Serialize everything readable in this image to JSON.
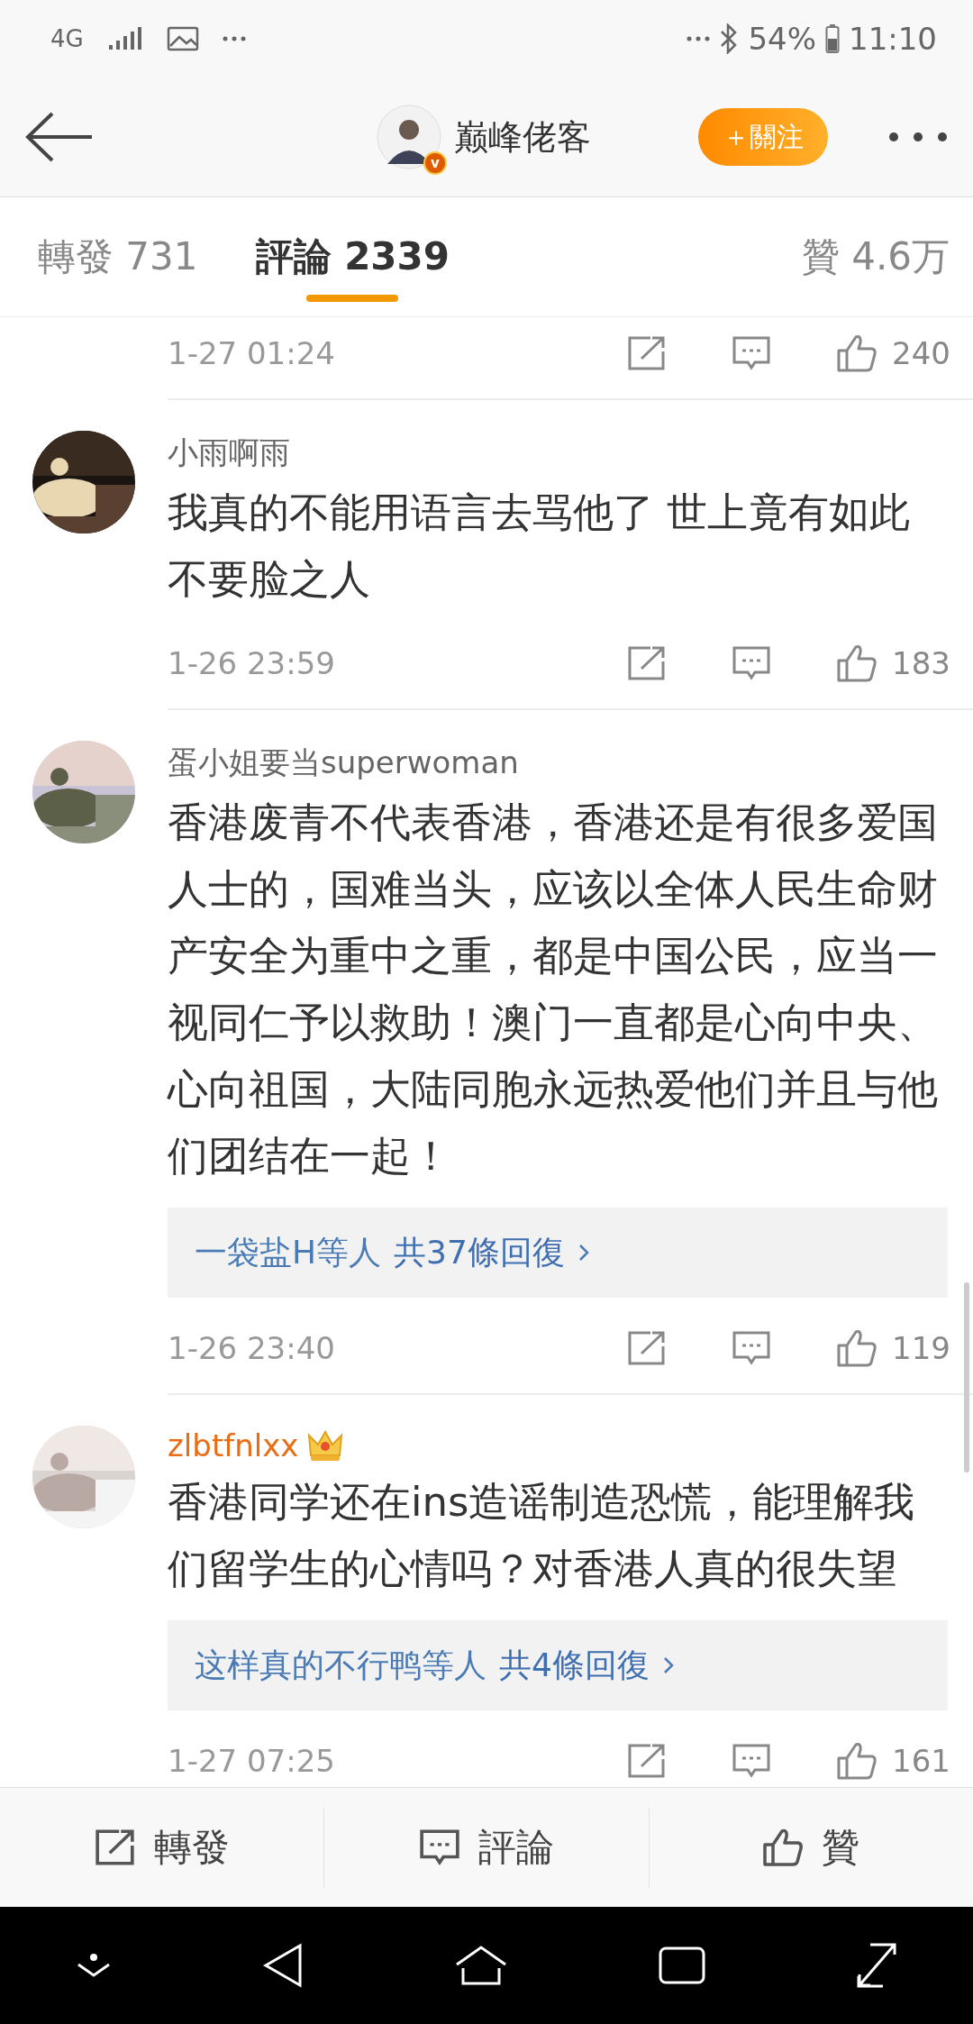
{
  "status_bar": {
    "network": "4G",
    "battery": "54%",
    "time": "11:10"
  },
  "header": {
    "title": "巅峰佬客",
    "badge": "v",
    "follow_button": "＋關注"
  },
  "tabs": [
    {
      "label": "轉發 731",
      "selected": false
    },
    {
      "label": "評論 2339",
      "selected": true
    },
    {
      "label": "贊 4.6万",
      "selected": false
    }
  ],
  "comments": [
    {
      "kind": "tail",
      "time": "1-27 01:24",
      "likes": "240"
    },
    {
      "kind": "full",
      "name": "小雨啊雨",
      "member": false,
      "text": "我真的不能用语言去骂他了  世上竟有如此不要脸之人",
      "time": "1-26 23:59",
      "likes": "183"
    },
    {
      "kind": "full",
      "name": "蛋小姐要当superwoman",
      "member": false,
      "text": "香港废青不代表香港，香港还是有很多爱国人士的，国难当头，应该以全体人民生命财产安全为重中之重，都是中国公民，应当一视同仁予以救助！澳门一直都是心向中央、心向祖国，大陆同胞永远热爱他们并且与他们团结在一起！",
      "replies": {
        "users": "一袋盐H等人",
        "total": "共37條回復"
      },
      "time": "1-26 23:40",
      "likes": "119"
    },
    {
      "kind": "full",
      "name": "zlbtfnlxx",
      "member": true,
      "text": "香港同学还在ins造谣制造恐慌，能理解我们留学生的心情吗？对香港人真的很失望",
      "replies": {
        "users": "这样真的不行鸭等人",
        "total": "共4條回復"
      },
      "time": "1-27 07:25",
      "likes": "161"
    }
  ],
  "bottom_bar": [
    "轉發",
    "評論",
    "贊"
  ]
}
